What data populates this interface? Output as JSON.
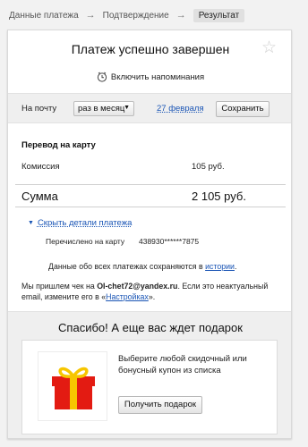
{
  "breadcrumbs": {
    "step1": "Данные платежа",
    "step2": "Подтверждение",
    "step3": "Результат",
    "separator": "→"
  },
  "header": {
    "title": "Платеж успешно завершен",
    "favorite_icon": "star-icon",
    "remind_icon": "clock-icon",
    "remind_label": "Включить напоминания"
  },
  "reminder": {
    "target_label": "На почту",
    "period_value": "раз в месяц",
    "date_value": "27 февраля",
    "save_label": "Сохранить"
  },
  "payment": {
    "transfer_label": "Перевод на карту",
    "fee_label": "Комиссия",
    "fee_value": "105 руб.",
    "total_label": "Сумма",
    "total_value": "2 105 руб."
  },
  "details": {
    "toggle_label": "Скрыть детали платежа",
    "credited_label": "Перечислено на карту",
    "card_number": "438930******7875",
    "history_text": "Данные обо всех платежах сохраняются в ",
    "history_link": "истории",
    "history_end": "."
  },
  "email_note": {
    "before": "Мы пришлем чек на ",
    "email": "OI-chet72@yandex.ru",
    "middle": ". Если это неактуальный email, измените его в «",
    "settings_link": "Настройках",
    "after": "»."
  },
  "gift": {
    "title": "Спасибо! А еще вас ждет подарок",
    "description": "Выберите любой скидочный или бонусный купон из списка",
    "button_label": "Получить подарок",
    "gift_icon": "gift-box-icon",
    "colors": {
      "box": "#e31b12",
      "ribbon": "#f7c600"
    }
  },
  "colors": {
    "link": "#1a55b5",
    "band": "#efefef",
    "page_bg": "#f2f2f2"
  }
}
